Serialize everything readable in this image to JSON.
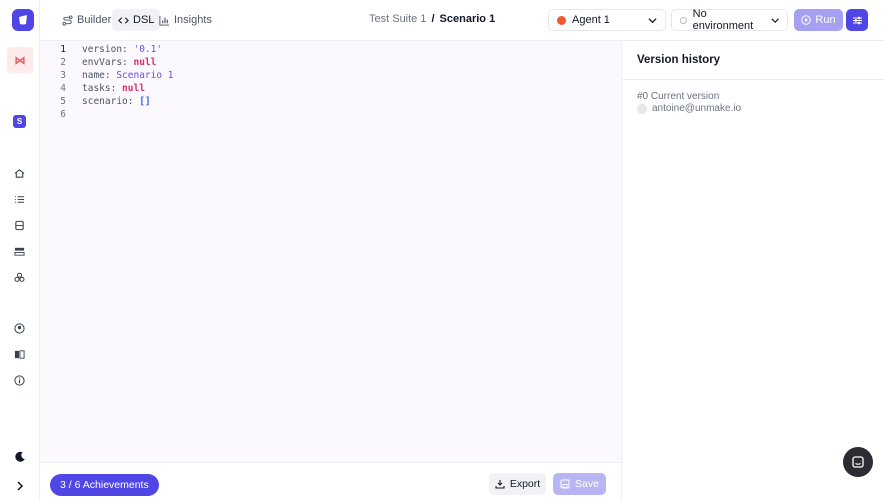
{
  "header": {
    "tabs": [
      {
        "label": "Builder",
        "icon": "route-icon",
        "active": false
      },
      {
        "label": "DSL",
        "icon": "code-icon",
        "active": true
      },
      {
        "label": "Insights",
        "icon": "bar-chart-icon",
        "active": false
      }
    ],
    "breadcrumb": {
      "suite": "Test Suite 1",
      "separator": "/",
      "scenario": "Scenario 1"
    },
    "agent_select": {
      "value": "Agent 1"
    },
    "environment_select": {
      "value": "No environment"
    },
    "run_label": "Run"
  },
  "sidebar": {
    "badge_letter": "S"
  },
  "editor": {
    "line_numbers": [
      "1",
      "2",
      "3",
      "4",
      "5",
      "6"
    ],
    "lines": [
      {
        "key": "version: ",
        "value": "'0.1'"
      },
      {
        "key": "envVars: ",
        "value": "null"
      },
      {
        "key": "name: ",
        "value": "Scenario 1"
      },
      {
        "key": "tasks: ",
        "value": "null"
      },
      {
        "key": "scenario: ",
        "value": "[]"
      },
      {
        "key": "",
        "value": ""
      }
    ]
  },
  "footer": {
    "achievements_label": "3 / 6 Achievements",
    "export_label": "Export",
    "save_label": "Save"
  },
  "version_panel": {
    "title": "Version history",
    "entries": [
      {
        "title": "#0 Current version",
        "user": "antoine@unmake.io"
      }
    ]
  },
  "colors": {
    "accent": "#4f46e5",
    "run_disabled": "#a5a0f1",
    "save_disabled": "#b9b5f4",
    "editor_bg": "#fbf9fd",
    "null_color": "#d6336c",
    "string_color": "#6b4fe0"
  }
}
